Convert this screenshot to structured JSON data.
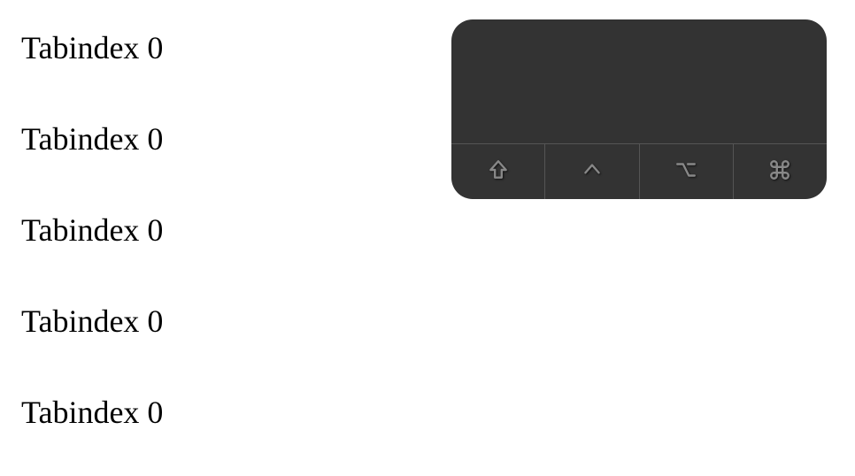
{
  "tabindex_items": [
    "Tabindex 0",
    "Tabindex 0",
    "Tabindex 0",
    "Tabindex 0",
    "Tabindex 0"
  ],
  "modifier_panel": {
    "keys": [
      {
        "name": "shift"
      },
      {
        "name": "control"
      },
      {
        "name": "option"
      },
      {
        "name": "command"
      }
    ]
  }
}
